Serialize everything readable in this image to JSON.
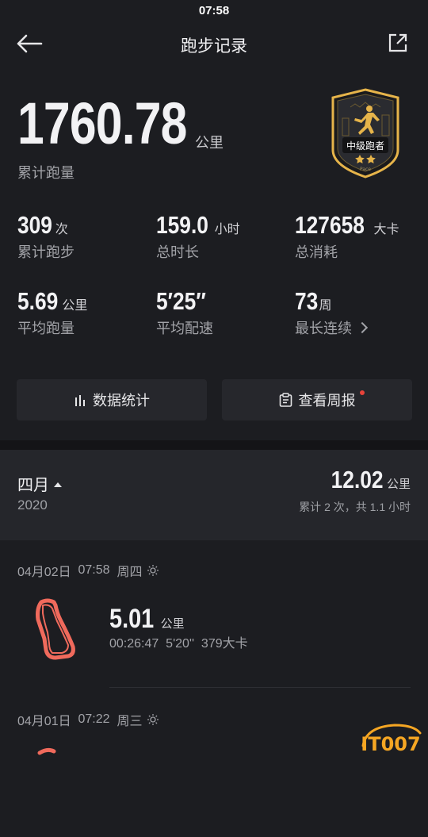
{
  "status_bar": {
    "time": "07:58"
  },
  "header": {
    "title": "跑步记录"
  },
  "total": {
    "value": "1760.78",
    "unit": "公里",
    "label": "累计跑量"
  },
  "badge": {
    "title": "中级跑者",
    "sub": "Pace"
  },
  "stats": [
    {
      "value": "309",
      "unit": "次",
      "label": "累计跑步"
    },
    {
      "value": "159.0",
      "unit": "小时",
      "label": "总时长"
    },
    {
      "value": "127658",
      "unit": "大卡",
      "label": "总消耗"
    },
    {
      "value": "5.69",
      "unit": "公里",
      "label": "平均跑量"
    },
    {
      "value": "5′25″",
      "unit": "",
      "label": "平均配速"
    },
    {
      "value": "73",
      "unit": "周",
      "label": "最长连续"
    }
  ],
  "buttons": {
    "stats_label": "数据统计",
    "report_label": "查看周报"
  },
  "month": {
    "name": "四月",
    "year": "2020",
    "distance": "12.02",
    "unit": "公里",
    "summary": "累计 2 次，共 1.1 小时"
  },
  "runs": [
    {
      "date": "04月02日",
      "time": "07:58",
      "weekday": "周四",
      "distance": "5.01",
      "unit": "公里",
      "duration": "00:26:47",
      "pace": "5'20''",
      "calories": "379大卡"
    },
    {
      "date": "04月01日",
      "time": "07:22",
      "weekday": "周三",
      "distance": "",
      "unit": "",
      "duration": "",
      "pace": "",
      "calories": ""
    }
  ],
  "watermark": {
    "text": "IT007"
  },
  "colors": {
    "background": "#1c1d21",
    "panel": "#25262b",
    "route": "#f06a5c",
    "badge_gold": "#e6b44a",
    "dot": "#e8433a"
  }
}
